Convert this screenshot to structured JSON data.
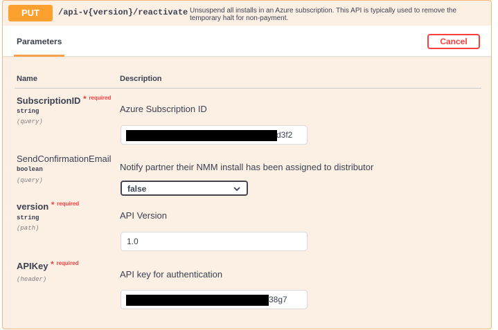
{
  "operation": {
    "method": "PUT",
    "path": "/api-v{version}/reactivate",
    "description": "Unsuspend all installs in an Azure subscription. This API is typically used to remove the temporary halt for non-payment.",
    "colors": {
      "accent": "#fca130",
      "border": "#f4b67d",
      "background": "#fcf0e5",
      "cancel": "#f93e3e"
    }
  },
  "section": {
    "tab": "Parameters",
    "cancel_label": "Cancel"
  },
  "columns": {
    "name": "Name",
    "description": "Description"
  },
  "parameters": [
    {
      "name": "SubscriptionID",
      "required_mark": "*",
      "required_label": "required",
      "type": "string",
      "in": "(query)",
      "description": "Azure Subscription ID",
      "value_suffix": "d3f2"
    },
    {
      "name": "SendConfirmationEmail",
      "type": "boolean",
      "in": "(query)",
      "description": "Notify partner their NMM install has been assigned to distributor",
      "selected": "false",
      "icon": "chevron-down-icon"
    },
    {
      "name": "version",
      "required_mark": "*",
      "required_label": "required",
      "type": "string",
      "in": "(path)",
      "description": "API Version",
      "value": "1.0"
    },
    {
      "name": "APIKey",
      "required_mark": "*",
      "required_label": "required",
      "in": "(header)",
      "description": "API key for authentication",
      "value_suffix": "38g7"
    }
  ]
}
